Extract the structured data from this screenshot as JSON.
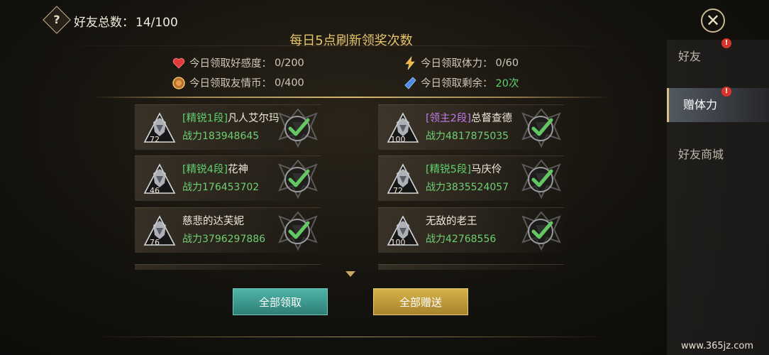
{
  "header": {
    "help_glyph": "?",
    "friends_total_label": "好友总数：",
    "friends_total_value": "14/100",
    "close_glyph": "✕"
  },
  "refresh_title": "每日5点刷新领奖次数",
  "stats": {
    "affection": {
      "label": "今日领取好感度：",
      "value": "0/200",
      "icon": "heart-icon"
    },
    "stamina": {
      "label": "今日领取体力：",
      "value": "0/60",
      "icon": "lightning-icon"
    },
    "coins": {
      "label": "今日领取友情币：",
      "value": "0/400",
      "icon": "coin-icon"
    },
    "remaining": {
      "label": "今日领取剩余：",
      "value": "20次",
      "icon": "crystal-icon"
    }
  },
  "friends": [
    {
      "rank": "[精锐1段]",
      "rank_color": "green",
      "name": "凡人艾尔玛",
      "power": "战力183948645",
      "level": "72"
    },
    {
      "rank": "[领主2段]",
      "rank_color": "purple",
      "name": "总督查德",
      "power": "战力4817875035",
      "level": "100"
    },
    {
      "rank": "[精锐4段]",
      "rank_color": "green",
      "name": "花神",
      "power": "战力176453702",
      "level": "46"
    },
    {
      "rank": "[精锐5段]",
      "rank_color": "green",
      "name": "马庆伶",
      "power": "战力3835524057",
      "level": "72"
    },
    {
      "rank": "",
      "rank_color": "green",
      "name": "慈悲的达芙妮",
      "power": "战力3796297886",
      "level": "76"
    },
    {
      "rank": "",
      "rank_color": "green",
      "name": "无敌的老王",
      "power": "战力42768556",
      "level": "100"
    }
  ],
  "buttons": {
    "claim_all": "全部领取",
    "gift_all": "全部赠送"
  },
  "tabs": [
    {
      "label": "好友",
      "badge": "!"
    },
    {
      "label": "赠体力",
      "badge": "!"
    },
    {
      "label": "好友商城",
      "badge": ""
    }
  ],
  "colors": {
    "accent_gold": "#e6c56a",
    "green": "#5fd06e",
    "purple": "#c27be8"
  },
  "watermark": "www.365jz.com"
}
